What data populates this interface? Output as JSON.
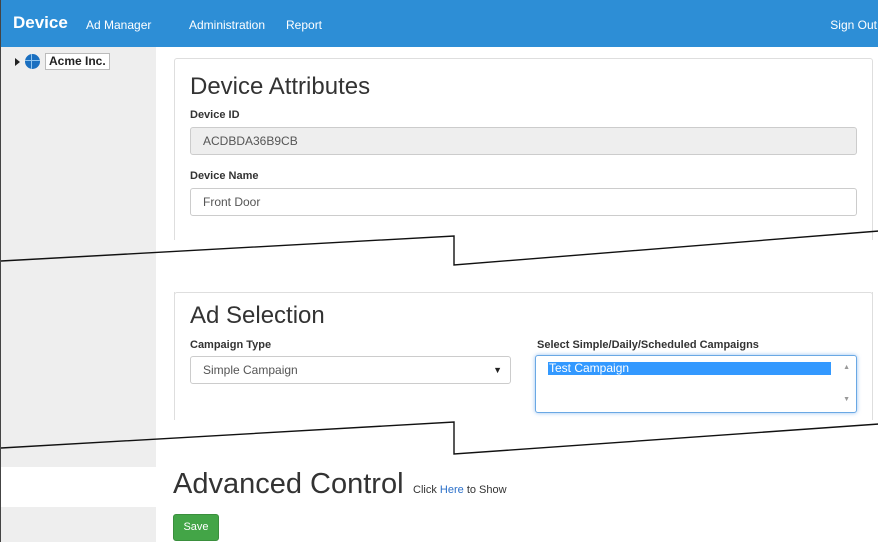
{
  "navbar": {
    "brand": "Device",
    "links": [
      "Ad Manager",
      "Administration",
      "Report"
    ],
    "sign_out": "Sign Out",
    "color": "#2d8ed6"
  },
  "sidebar": {
    "tree": [
      {
        "label": "Acme Inc.",
        "icon": "globe-icon",
        "expanded": false
      }
    ]
  },
  "device_attributes": {
    "title": "Device Attributes",
    "device_id_label": "Device ID",
    "device_id_value": "ACDBDA36B9CB",
    "device_name_label": "Device Name",
    "device_name_value": "Front Door"
  },
  "ad_selection": {
    "title": "Ad Selection",
    "campaign_type_label": "Campaign Type",
    "campaign_type_value": "Simple Campaign",
    "campaigns_label": "Select Simple/Daily/Scheduled Campaigns",
    "campaigns": [
      {
        "label": "Test Campaign",
        "selected": true
      }
    ]
  },
  "advanced": {
    "title": "Advanced Control",
    "hint_prefix": "Click",
    "hint_link": "Here",
    "hint_suffix": "to Show"
  },
  "actions": {
    "save_label": "Save",
    "save_color": "#43a547"
  }
}
